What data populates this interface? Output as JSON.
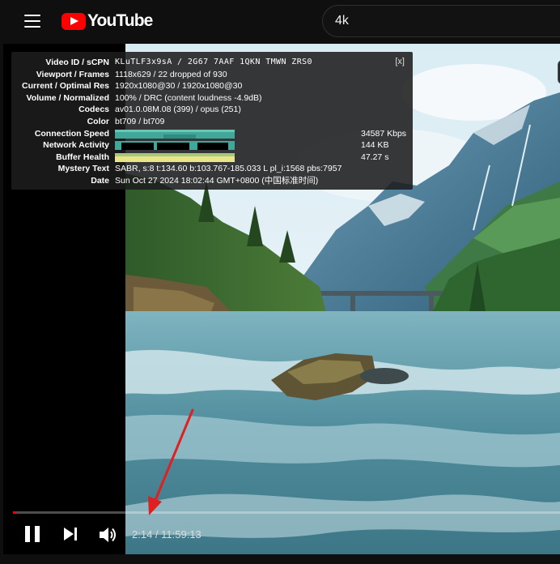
{
  "header": {
    "logo_text": "YouTube",
    "search_value": "4k"
  },
  "stats": {
    "close_label": "[x]",
    "rows": [
      {
        "label": "Video ID / sCPN",
        "value": "KLuTLF3x9sA / 2G67 7AAF 1QKN TMWN ZRS0"
      },
      {
        "label": "Viewport / Frames",
        "value": "1118x629 / 22 dropped of 930"
      },
      {
        "label": "Current / Optimal Res",
        "value": "1920x1080@30 / 1920x1080@30"
      },
      {
        "label": "Volume / Normalized",
        "value": "100% / DRC (content loudness -4.9dB)"
      },
      {
        "label": "Codecs",
        "value": "av01.0.08M.08 (399) / opus (251)"
      },
      {
        "label": "Color",
        "value": "bt709 / bt709"
      },
      {
        "label": "Connection Speed",
        "value": "34587 Kbps"
      },
      {
        "label": "Network Activity",
        "value": "144 KB"
      },
      {
        "label": "Buffer Health",
        "value": "47.27 s"
      },
      {
        "label": "Mystery Text",
        "value": "SABR, s:8 t:134.60 b:103.767-185.033 L pl_i:1568 pbs:7957"
      },
      {
        "label": "Date",
        "value": "Sun Oct 27 2024 18:02:44 GMT+0800 (中国标准时间)"
      }
    ]
  },
  "player": {
    "time": "2:14 / 11:59:13",
    "progress_fraction": 0.0031
  },
  "colors": {
    "brand_red": "#ff0000",
    "annotation_arrow": "#e02020",
    "graph_teal": "#3fa89a",
    "graph_yellow": "#e7e48a"
  }
}
